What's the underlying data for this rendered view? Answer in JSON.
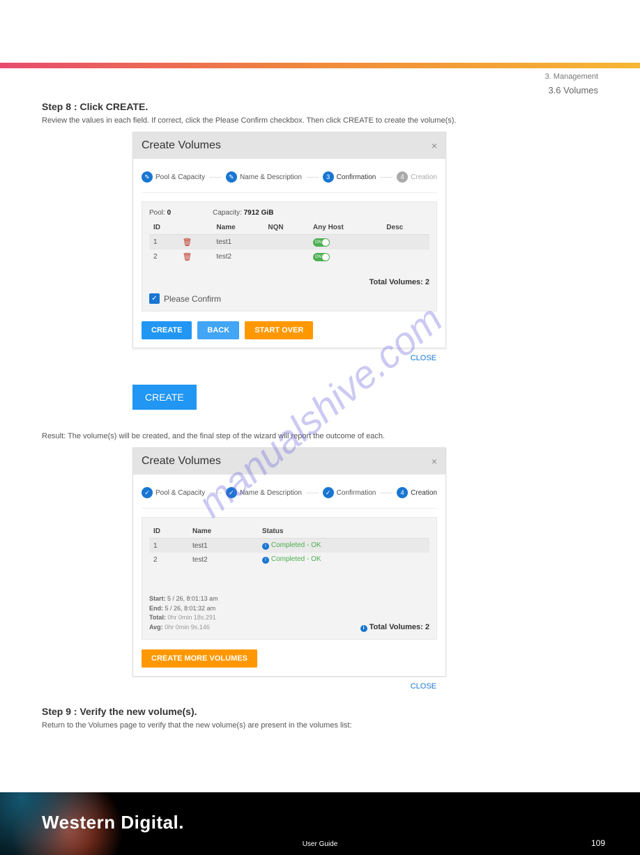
{
  "chapter": "3. Management",
  "section": "3.6 Volumes",
  "watermark": "manualshive.com",
  "step8": {
    "heading": "Step 8 : Click CREATE.",
    "body": "Review the values in each field. If correct, click the Please Confirm checkbox. Then click CREATE to create the volume(s)."
  },
  "dialog1": {
    "title": "Create Volumes",
    "steps": {
      "s1": "Pool & Capacity",
      "s2": "Name & Description",
      "s3": "Confirmation",
      "s4": "Creation",
      "n3": "3",
      "n4": "4"
    },
    "pool_label": "Pool:",
    "pool_value": "0",
    "cap_label": "Capacity:",
    "cap_value": "7912 GiB",
    "headers": {
      "id": "ID",
      "name": "Name",
      "nqn": "NQN",
      "anyhost": "Any Host",
      "desc": "Desc"
    },
    "rows": [
      {
        "id": "1",
        "name": "test1",
        "toggle": "ON"
      },
      {
        "id": "2",
        "name": "test2",
        "toggle": "ON"
      }
    ],
    "total": "Total Volumes: 2",
    "confirm": "Please Confirm",
    "buttons": {
      "create": "CREATE",
      "back": "BACK",
      "start_over": "START OVER"
    },
    "close": "CLOSE"
  },
  "big_create": "CREATE",
  "result_text": "Result: The volume(s) will be created, and the final step of the wizard will report the outcome of each.",
  "dialog2": {
    "title": "Create Volumes",
    "steps": {
      "s1": "Pool & Capacity",
      "s2": "Name & Description",
      "s3": "Confirmation",
      "s4": "Creation",
      "n4": "4"
    },
    "headers": {
      "id": "ID",
      "name": "Name",
      "status": "Status"
    },
    "rows": [
      {
        "id": "1",
        "name": "test1",
        "status": "Completed - OK"
      },
      {
        "id": "2",
        "name": "test2",
        "status": "Completed - OK"
      }
    ],
    "timing": {
      "start_l": "Start:",
      "start_v": "5 / 26, 8:01:13 am",
      "end_l": "End:",
      "end_v": "5 / 26, 8:01:32 am",
      "total_l": "Total:",
      "total_v": "0hr 0min 18s.291",
      "avg_l": "Avg:",
      "avg_v": "0hr 0min 9s.146"
    },
    "total": "Total Volumes: 2",
    "more": "CREATE MORE VOLUMES",
    "close": "CLOSE"
  },
  "step9": {
    "heading": "Step 9 : Verify the new volume(s).",
    "body": "Return to the Volumes page to verify that the new volume(s) are present in the volumes list:"
  },
  "footer": {
    "brand": "Western Digital.",
    "doc": "User Guide",
    "page": "109"
  }
}
